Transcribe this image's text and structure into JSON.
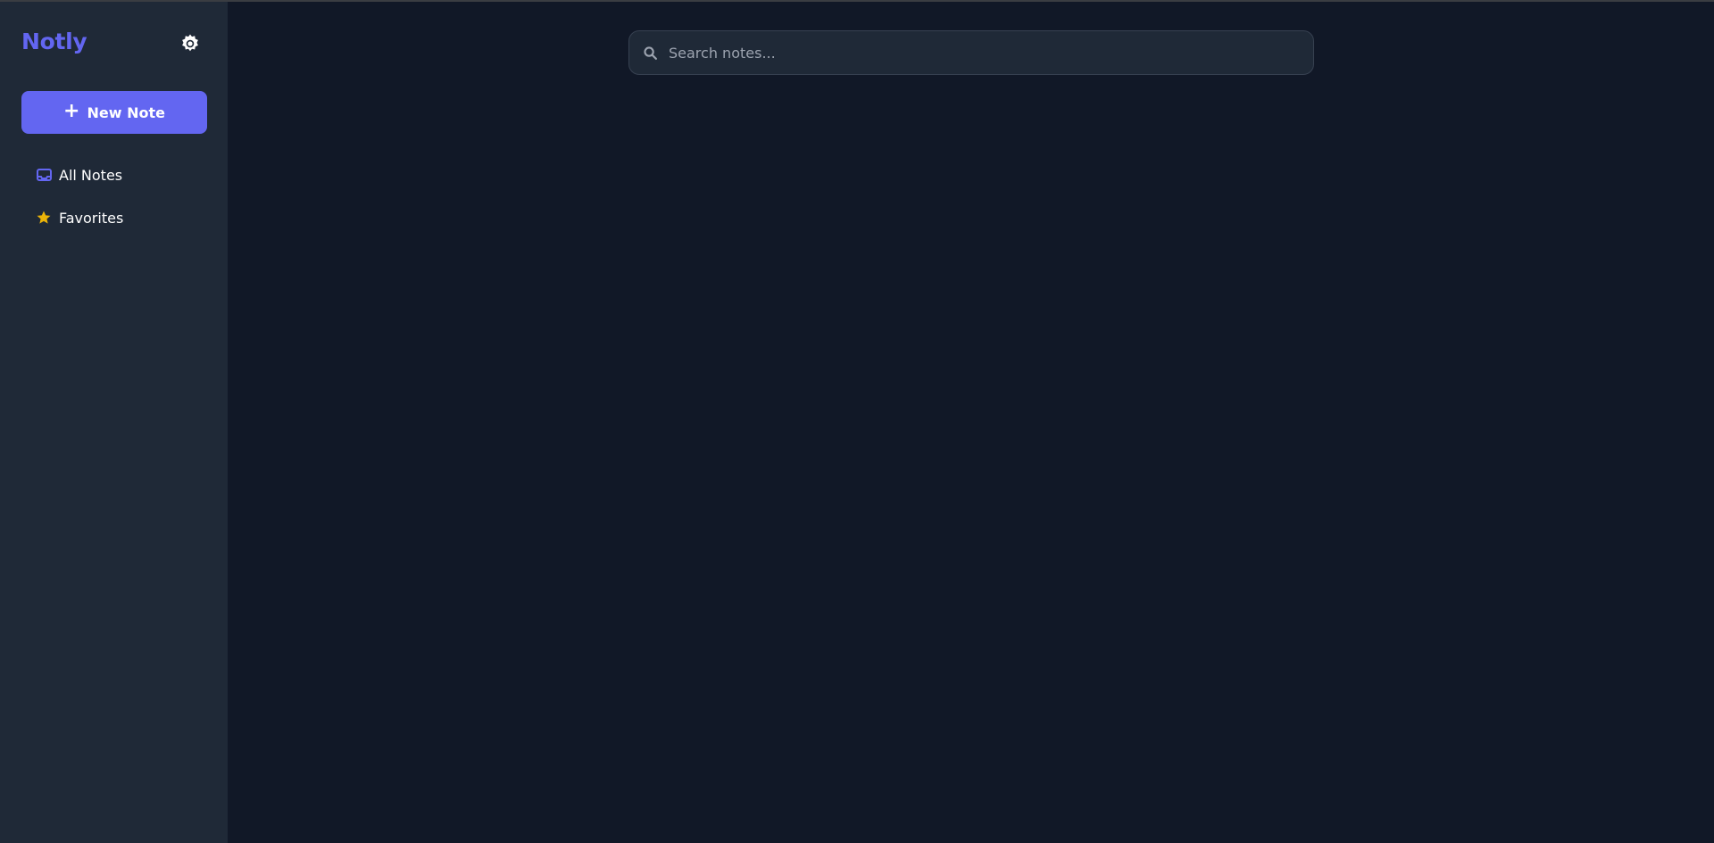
{
  "sidebar": {
    "brand": "Notly",
    "settings_icon": "gear-icon",
    "new_note_label": "New Note",
    "items": [
      {
        "label": "All Notes",
        "icon": "inbox-icon",
        "icon_color": "#6366f1"
      },
      {
        "label": "Favorites",
        "icon": "star-icon",
        "icon_color": "#eab308"
      }
    ]
  },
  "search": {
    "placeholder": "Search notes...",
    "value": ""
  },
  "colors": {
    "accent": "#6366f1",
    "sidebar_bg": "#1f2937",
    "main_bg": "#111827",
    "favorite": "#eab308"
  }
}
